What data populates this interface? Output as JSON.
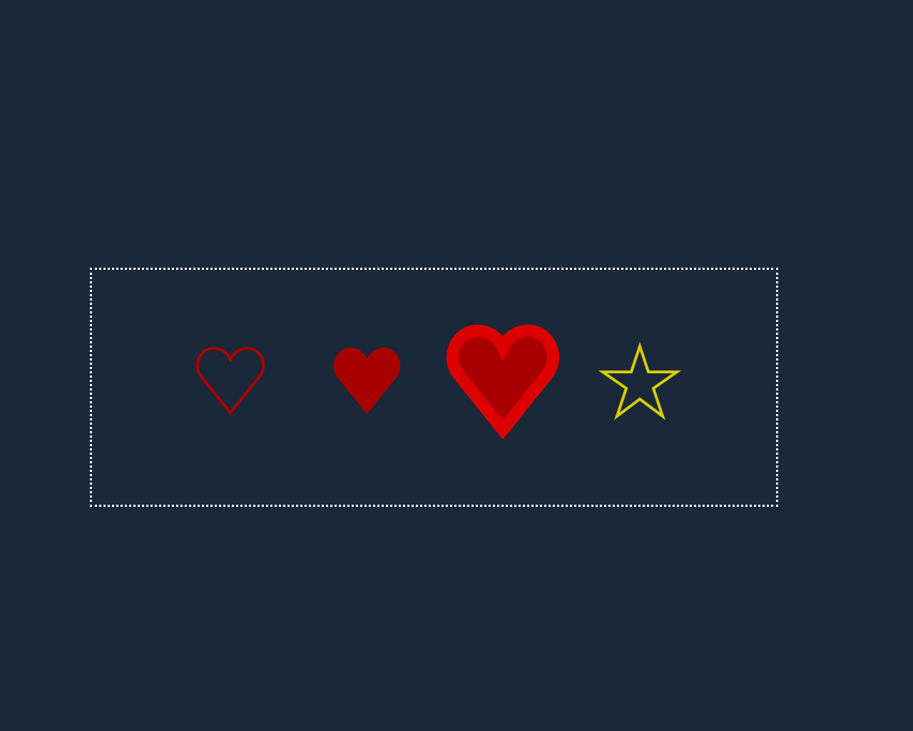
{
  "icons": [
    {
      "name": "heart-outline-icon",
      "style": "outline",
      "stroke": "#b00000",
      "fill": "none"
    },
    {
      "name": "heart-filled-icon",
      "style": "filled",
      "stroke": "none",
      "fill": "#a80000"
    },
    {
      "name": "heart-large-filled-icon",
      "style": "filled-with-border",
      "stroke": "#dd0000",
      "fill": "#a80000"
    },
    {
      "name": "star-outline-icon",
      "style": "outline",
      "stroke": "#d4cc00",
      "fill": "none"
    }
  ],
  "colors": {
    "background": "#1b2839",
    "panel_border": "#ffffff"
  }
}
